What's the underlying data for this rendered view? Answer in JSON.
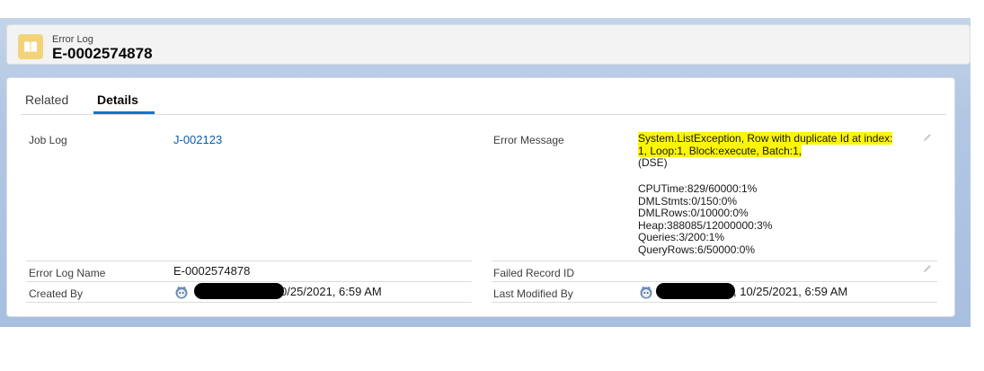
{
  "header": {
    "object_type": "Error Log",
    "record_name": "E-0002574878"
  },
  "tabs": [
    {
      "label": "Related",
      "active": false
    },
    {
      "label": "Details",
      "active": true
    }
  ],
  "fields": {
    "job_log": {
      "label": "Job Log",
      "value": "J-002123"
    },
    "error_message": {
      "label": "Error Message",
      "highlighted_line_1": "System.ListException, Row with duplicate Id at index:",
      "highlighted_line_2": "1, Loop:1, Block:execute, Batch:1,",
      "line_3": "(DSE)",
      "metrics": [
        "CPUTime:829/60000:1%",
        "DMLStmts:0/150:0%",
        "DMLRows:0/10000:0%",
        "Heap:388085/12000000:3%",
        "Queries:3/200:1%",
        "QueryRows:6/50000:0%"
      ]
    },
    "error_log_name": {
      "label": "Error Log Name",
      "value": "E-0002574878"
    },
    "failed_record_id": {
      "label": "Failed Record ID",
      "value": ""
    },
    "created_by": {
      "label": "Created By",
      "value": "0/25/2021, 6:59 AM"
    },
    "last_modified_by": {
      "label": "Last Modified By",
      "value": ", 10/25/2021, 6:59 AM"
    }
  },
  "colors": {
    "accent": "#0176d3",
    "link": "#0b5cab",
    "highlight": "#fbf50a",
    "object_icon": "#f3d37a"
  },
  "icons": {
    "object_icon": "book-icon",
    "edit_icon": "pencil-icon",
    "avatar": "user-avatar-icon"
  }
}
